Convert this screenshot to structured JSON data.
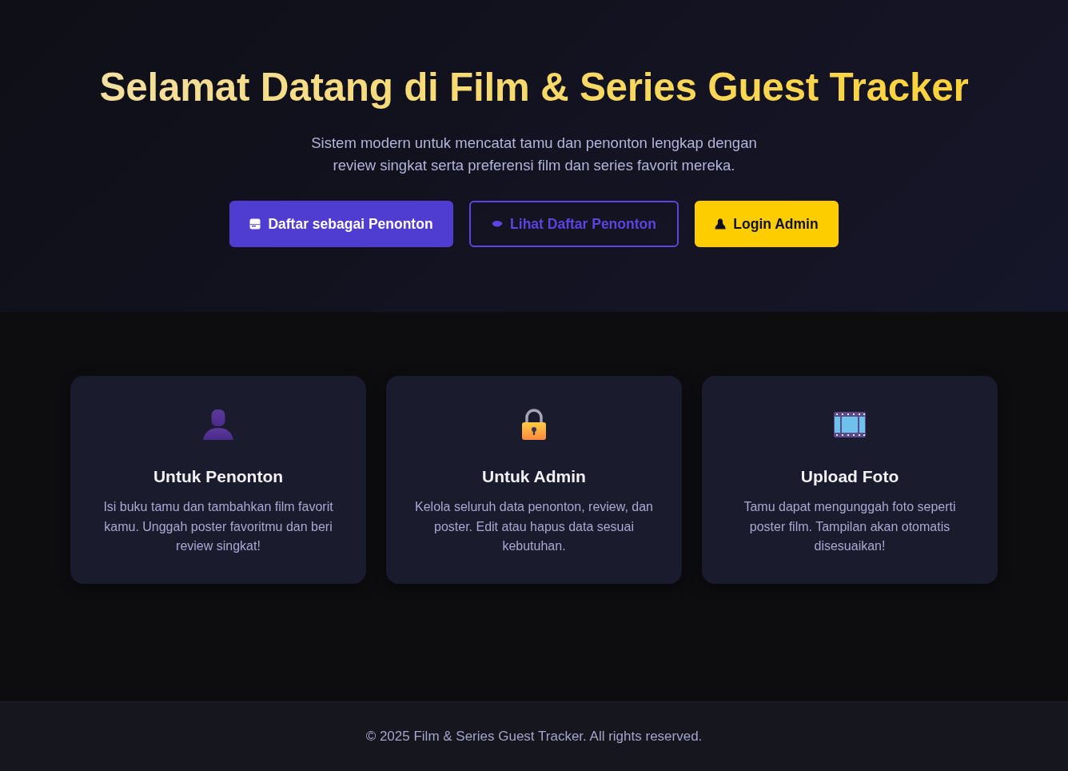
{
  "hero": {
    "title": "Selamat Datang di Film & Series Guest Tracker",
    "subtitle": "Sistem modern untuk mencatat tamu dan penonton lengkap dengan review singkat serta preferensi film dan series favorit mereka.",
    "buttons": [
      {
        "label": "Daftar sebagai Penonton",
        "kind": "primary"
      },
      {
        "label": "Lihat Daftar Penonton",
        "kind": "outline"
      },
      {
        "label": "Login Admin",
        "kind": "accent"
      }
    ]
  },
  "features": [
    {
      "title": "Untuk Penonton",
      "text": "Isi buku tamu dan tambahkan film favorit kamu. Unggah poster favoritmu dan beri review singkat!"
    },
    {
      "title": "Untuk Admin",
      "text": "Kelola seluruh data penonton, review, dan poster. Edit atau hapus data sesuai kebutuhan."
    },
    {
      "title": "Upload Foto",
      "text": "Tamu dapat mengunggah foto seperti poster film. Tampilan akan otomatis disesuaikan!"
    }
  ],
  "footer": {
    "text": "© 2025 Film & Series Guest Tracker. All rights reserved."
  }
}
